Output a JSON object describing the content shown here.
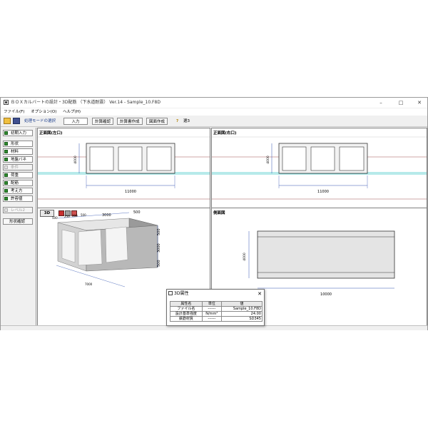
{
  "window": {
    "title": "ＢＯＸカルバートの設計・3D配筋 （下水道耐震） Ver.14 - Sample_10.F8D",
    "controls": {
      "minimize": "–",
      "maximize": "□",
      "close": "✕"
    }
  },
  "menu": [
    "ファイル(F)",
    "オプション(O)",
    "ヘルプ(H)"
  ],
  "toolbar": {
    "mode_label": "処理モードの選択",
    "mode_value": "入力",
    "buttons": [
      "計算確認",
      "計算書作成",
      "図面作成"
    ],
    "help_icon": "help-question-icon",
    "help_label": "?",
    "right_label": "選3"
  },
  "sidebar": {
    "items": [
      {
        "label": "初期入力",
        "checked": true,
        "enabled": true
      },
      {
        "label": "形状",
        "checked": true,
        "enabled": true
      },
      {
        "label": "材料",
        "checked": true,
        "enabled": true
      },
      {
        "label": "地盤バネ",
        "checked": true,
        "enabled": true
      },
      {
        "label": "条件",
        "checked": false,
        "enabled": false
      },
      {
        "label": "荷重",
        "checked": true,
        "enabled": true
      },
      {
        "label": "配筋",
        "checked": true,
        "enabled": true
      },
      {
        "label": "考え方",
        "checked": true,
        "enabled": true
      },
      {
        "label": "許容値",
        "checked": true,
        "enabled": true
      }
    ],
    "level2": "レベル2",
    "shape_check": "形状確認"
  },
  "panes": {
    "front_left": {
      "title": "正面図(左口)",
      "width_dim": "11000",
      "height_dim": "4000"
    },
    "front_right": {
      "title": "正面図(右口)",
      "width_dim": "11000",
      "height_dim": "4000"
    },
    "view3d": {
      "button": "3D",
      "dims": {
        "top": "3000",
        "top2": "500",
        "depth": "7000",
        "left_a": "500",
        "right_v1": "500",
        "right_v2": "3000",
        "right_v3": "500",
        "small1": "250",
        "small2": "300",
        "small3": "500"
      }
    },
    "side": {
      "title": "側面図",
      "length_dim": "10000",
      "height_dim": "4000"
    }
  },
  "dialog": {
    "title": "3D属性",
    "close": "✕",
    "headers": [
      "属性名",
      "単位",
      "値"
    ],
    "rows": [
      [
        "ファイル名",
        "------",
        "Sample_10.F8D"
      ],
      [
        "設計基準強度",
        "N/mm²",
        "24.00"
      ],
      [
        "鉄筋材質",
        "------",
        "SD345"
      ]
    ]
  },
  "colors": {
    "toolbar_text": "#1a3c8c",
    "groundwater": "#3cc8c8",
    "ground_line": "#a05050",
    "dim_line": "#3050b0",
    "check": "#2e8b2e"
  }
}
